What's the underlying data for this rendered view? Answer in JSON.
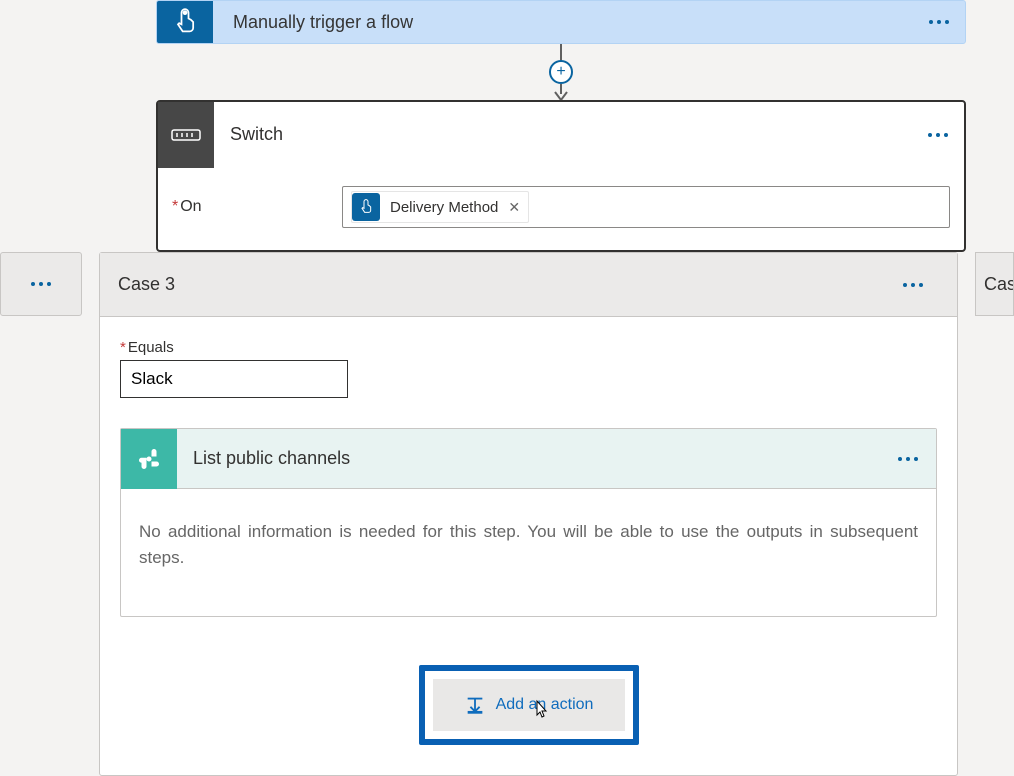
{
  "trigger": {
    "title": "Manually trigger a flow"
  },
  "switch": {
    "title": "Switch",
    "field_label": "On",
    "token_label": "Delivery Method"
  },
  "case3": {
    "title": "Case 3",
    "equals_label": "Equals",
    "equals_value": "Slack",
    "action": {
      "title": "List public channels",
      "description": "No additional information is needed for this step. You will be able to use the outputs in subsequent steps."
    },
    "add_action_label": "Add an action"
  },
  "case_right": {
    "title": "Cas"
  }
}
